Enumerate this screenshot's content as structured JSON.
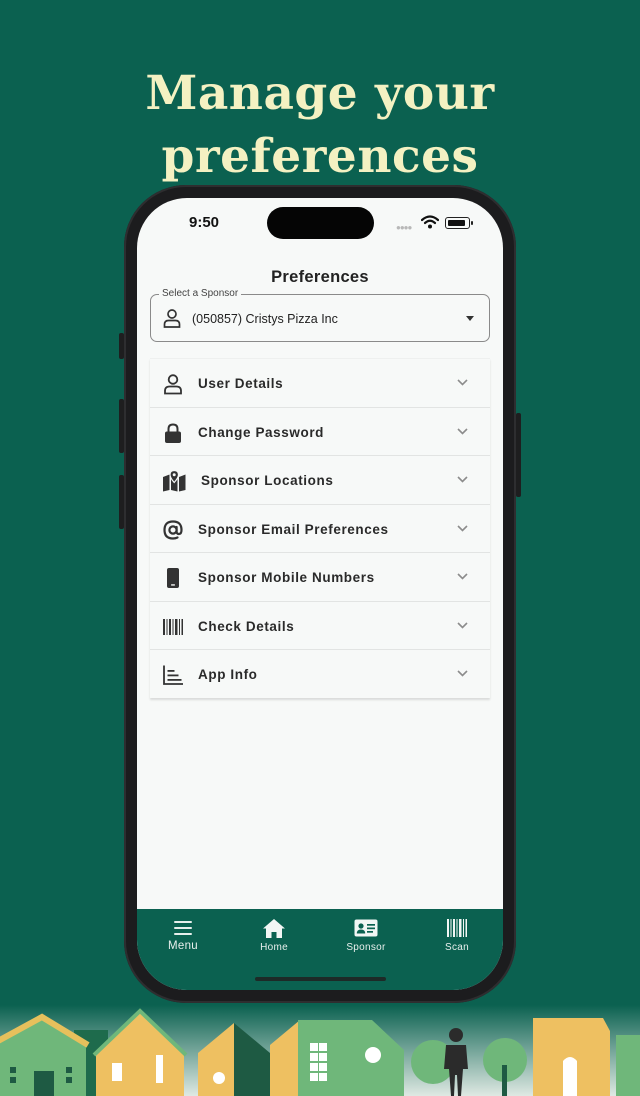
{
  "headline": {
    "line1": "Manage your",
    "line2": "preferences"
  },
  "status_bar": {
    "time": "9:50"
  },
  "page": {
    "title": "Preferences"
  },
  "sponsor": {
    "label": "Select a Sponsor",
    "value": "(050857) Cristys Pizza Inc"
  },
  "sections": [
    {
      "label": "User Details",
      "icon": "person-icon"
    },
    {
      "label": "Change Password",
      "icon": "lock-icon"
    },
    {
      "label": "Sponsor Locations",
      "icon": "map-icon"
    },
    {
      "label": "Sponsor Email Preferences",
      "icon": "at-sign-icon"
    },
    {
      "label": "Sponsor Mobile Numbers",
      "icon": "mobile-phone-icon"
    },
    {
      "label": "Check Details",
      "icon": "barcode-icon"
    },
    {
      "label": "App Info",
      "icon": "chart-icon"
    }
  ],
  "tabbar": {
    "tabs": [
      {
        "label": "Menu",
        "icon": "hamburger-icon"
      },
      {
        "label": "Home",
        "icon": "home-icon"
      },
      {
        "label": "Sponsor",
        "icon": "id-card-icon"
      },
      {
        "label": "Scan",
        "icon": "barcode-icon"
      }
    ]
  },
  "colors": {
    "brand_green": "#0b6150",
    "headline_cream": "#f4f1c2",
    "screen_bg": "#f7f9f8"
  }
}
